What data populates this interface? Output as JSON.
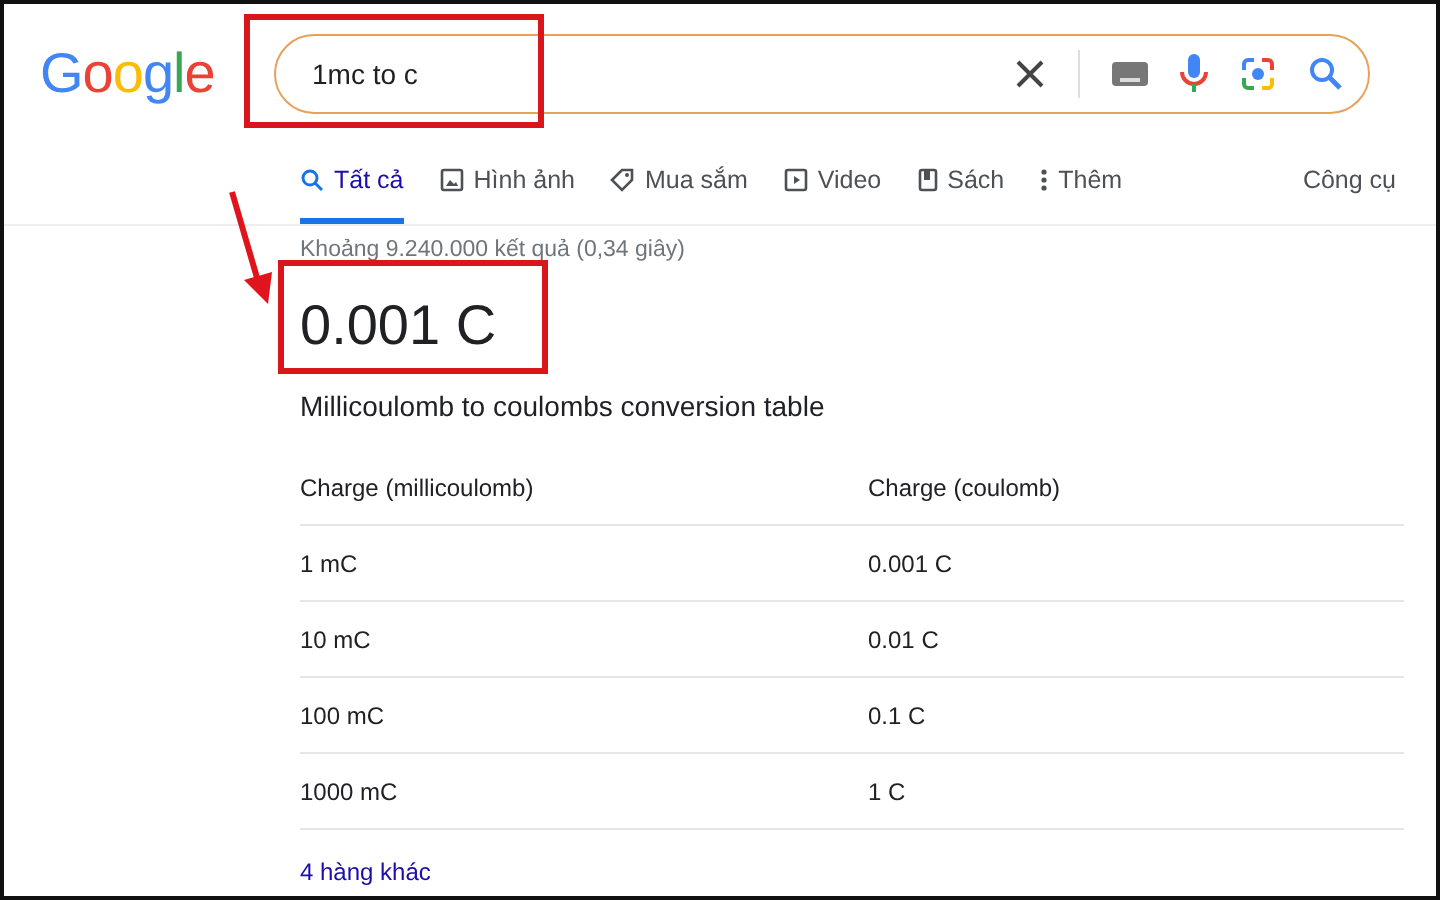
{
  "logo": "Google",
  "search": {
    "value": "1mc to c"
  },
  "tabs": [
    {
      "label": "Tất cả",
      "kind": "all",
      "selected": true
    },
    {
      "label": "Hình ảnh",
      "kind": "images",
      "selected": false
    },
    {
      "label": "Mua sắm",
      "kind": "shopping",
      "selected": false
    },
    {
      "label": "Video",
      "kind": "videos",
      "selected": false
    },
    {
      "label": "Sách",
      "kind": "books",
      "selected": false
    },
    {
      "label": "Thêm",
      "kind": "more",
      "selected": false
    }
  ],
  "tools": "Công cụ",
  "stats": "Khoảng 9.240.000 kết quả (0,34 giây)",
  "answer": "0.001 C",
  "table": {
    "title": "Millicoulomb to coulombs conversion table",
    "columns": [
      "Charge (millicoulomb)",
      "Charge (coulomb)"
    ],
    "rows": [
      [
        "1 mC",
        "0.001 C"
      ],
      [
        "10 mC",
        "0.01 C"
      ],
      [
        "100 mC",
        "0.1 C"
      ],
      [
        "1000 mC",
        "1 C"
      ]
    ],
    "more_link": "4 hàng khác"
  }
}
